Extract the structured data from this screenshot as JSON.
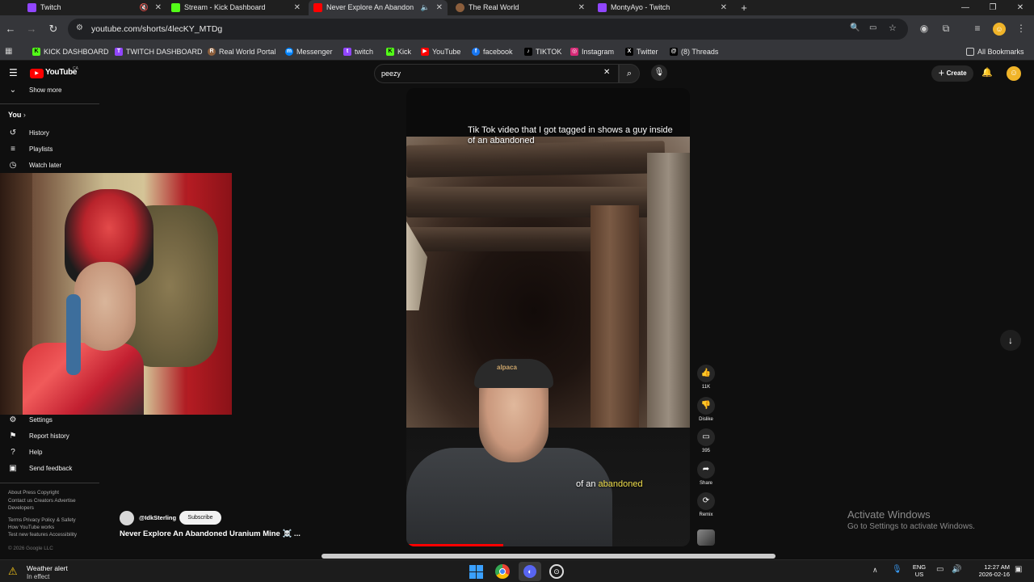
{
  "browser": {
    "tabs": [
      {
        "title": "Twitch",
        "active": false,
        "color": "#9146ff",
        "muted": true
      },
      {
        "title": "Stream - Kick Dashboard",
        "active": false,
        "color": "#53fc18",
        "muted": false
      },
      {
        "title": "Never Explore An Abandon",
        "active": true,
        "color": "#ff0000",
        "muted": true
      },
      {
        "title": "The Real World",
        "active": false,
        "color": "#8b5e3c",
        "muted": false
      },
      {
        "title": "MontyAyo - Twitch",
        "active": false,
        "color": "#9146ff",
        "muted": false
      }
    ],
    "new_tab": "+",
    "url": "youtube.com/shorts/4lecKY_MTDg",
    "bookmarks": [
      {
        "label": "KICK DASHBOARD",
        "icon": "K",
        "color": "#53fc18"
      },
      {
        "label": "TWITCH DASHBOARD",
        "icon": "T",
        "color": "#9146ff"
      },
      {
        "label": "Real World Portal",
        "icon": "R",
        "color": "#8b5e3c"
      },
      {
        "label": "Messenger",
        "icon": "m",
        "color": "#0084ff"
      },
      {
        "label": "twitch",
        "icon": "t",
        "color": "#9146ff"
      },
      {
        "label": "Kick",
        "icon": "K",
        "color": "#53fc18"
      },
      {
        "label": "YouTube",
        "icon": "▶",
        "color": "#ff0000"
      },
      {
        "label": "facebook",
        "icon": "f",
        "color": "#1877f2"
      },
      {
        "label": "TIKTOK",
        "icon": "♪",
        "color": "#000000"
      },
      {
        "label": "Instagram",
        "icon": "◎",
        "color": "#d62976"
      },
      {
        "label": "Twitter",
        "icon": "X",
        "color": "#000000"
      },
      {
        "label": "(8) Threads",
        "icon": "@",
        "color": "#000000"
      }
    ],
    "all_bookmarks": "All Bookmarks"
  },
  "youtube": {
    "logo_text": "YouTube",
    "logo_region": "CA",
    "search_value": "peezy",
    "create_label": "Create",
    "sidebar": {
      "show_more": "Show more",
      "you": "You",
      "items_top": [
        "History",
        "Playlists",
        "Watch later"
      ],
      "items_bottom": [
        "Settings",
        "Report history",
        "Help",
        "Send feedback"
      ],
      "footer": [
        "About  Press  Copyright",
        "Contact us  Creators  Advertise",
        "Developers",
        "Terms  Privacy  Policy & Safety",
        "How YouTube works",
        "Test new features  Accessibility",
        "© 2026 Google LLC"
      ]
    },
    "short": {
      "caption_top": "Tik Tok video that I got tagged in shows a guy inside of an abandoned",
      "caption_bottom_prefix": "of an ",
      "caption_bottom_highlight": "abandoned",
      "channel": "@IdkSterling",
      "subscribe": "Subscribe",
      "title": "Never Explore An Abandoned Uranium Mine ☠️ ...",
      "hat_text": "alpaca"
    },
    "actions": [
      {
        "icon": "like-icon",
        "glyph": "👍",
        "label": "11K"
      },
      {
        "icon": "dislike-icon",
        "glyph": "👎",
        "label": "Dislike"
      },
      {
        "icon": "comment-icon",
        "glyph": "▭",
        "label": "395"
      },
      {
        "icon": "share-icon",
        "glyph": "➦",
        "label": "Share"
      },
      {
        "icon": "remix-icon",
        "glyph": "⟳",
        "label": "Remix"
      }
    ]
  },
  "watermark": {
    "title": "Activate Windows",
    "subtitle": "Go to Settings to activate Windows."
  },
  "taskbar": {
    "weather_title": "Weather alert",
    "weather_sub": "In effect",
    "lang_top": "ENG",
    "lang_bottom": "US",
    "time": "12:27 AM",
    "date": "2026-02-16"
  }
}
